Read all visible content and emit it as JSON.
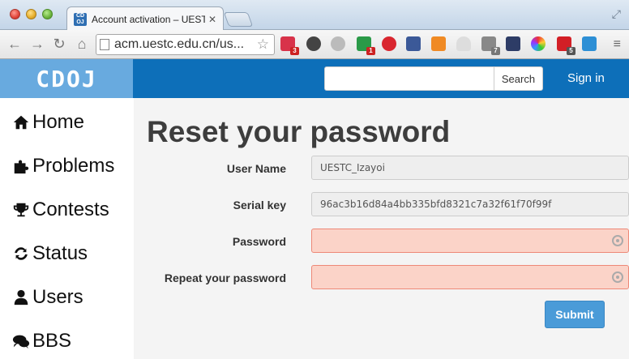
{
  "browser": {
    "tab_title": "Account activation – UESTC",
    "tab_favicon_text": "CD OJ",
    "url": "acm.uestc.edu.cn/us...",
    "extension_badges": {
      "ext1": "3",
      "ext2": "1",
      "ext3": "7",
      "ext4": "5"
    }
  },
  "navbar": {
    "brand": "CDOJ",
    "search_placeholder": "",
    "search_button": "Search",
    "signin": "Sign in"
  },
  "sidebar": {
    "items": [
      {
        "label": "Home",
        "icon": "home-icon"
      },
      {
        "label": "Problems",
        "icon": "puzzle-icon"
      },
      {
        "label": "Contests",
        "icon": "trophy-icon"
      },
      {
        "label": "Status",
        "icon": "refresh-icon"
      },
      {
        "label": "Users",
        "icon": "user-icon"
      },
      {
        "label": "BBS",
        "icon": "comments-icon"
      }
    ]
  },
  "form": {
    "title": "Reset your password",
    "username_label": "User Name",
    "username_value": "UESTC_Izayoi",
    "serial_label": "Serial key",
    "serial_value": "96ac3b16d84a4bb335bfd8321c7a32f61f70f99f",
    "password_label": "Password",
    "password_value": "",
    "repeat_label": "Repeat your password",
    "repeat_value": "",
    "submit": "Submit"
  },
  "colors": {
    "navbar_bg": "#0d6fb9",
    "brand_bg": "#68aadf",
    "error_field_bg": "#fbd3c8",
    "submit_bg": "#4a9bd8"
  }
}
